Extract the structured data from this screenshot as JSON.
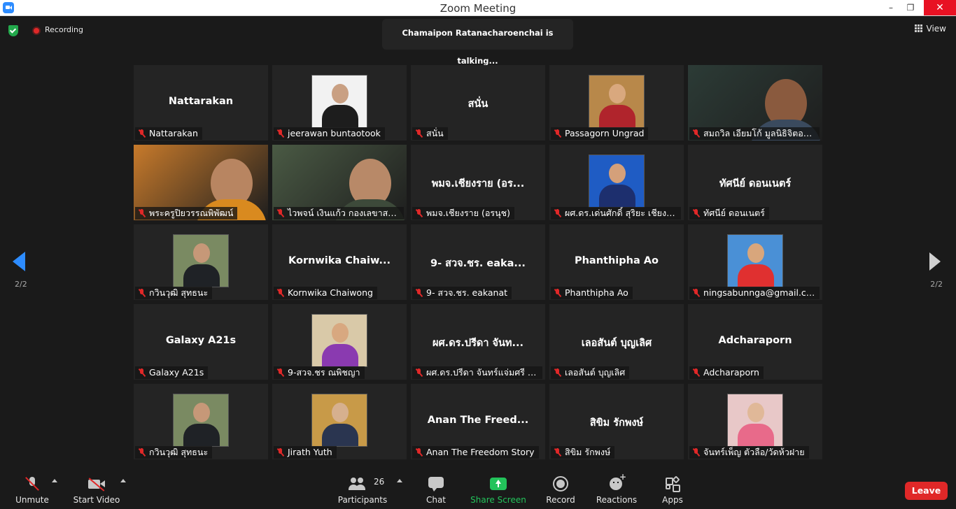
{
  "window": {
    "title": "Zoom Meeting",
    "minimize": "–",
    "maximize": "❐",
    "close": "✕"
  },
  "topbar": {
    "recording_label": "Recording",
    "talking_banner": "Chamaipon Ratanacharoenchai is talking...",
    "view_label": "View"
  },
  "pagination": {
    "left": "2/2",
    "right": "2/2"
  },
  "tiles": [
    {
      "name": "Nattarakan",
      "label": "Nattarakan",
      "kind": "name"
    },
    {
      "name": "",
      "label": "jeerawan buntaotook",
      "kind": "photo",
      "bg": "#f2f2f2",
      "skin": "#c9a083",
      "shirt": "#1d1d1d"
    },
    {
      "name": "สนั่น",
      "label": "สนั่น",
      "kind": "name"
    },
    {
      "name": "",
      "label": "Passagorn Ungrad",
      "kind": "photo",
      "bg": "#b8884a",
      "skin": "#d9a87e",
      "shirt": "#b0242c"
    },
    {
      "name": "",
      "label": "สมถวิล  เอียมโก้ มูลนิธิจิตอาสา เ...",
      "kind": "video",
      "bg": "#2c3b36",
      "skin": "#8a5a3e",
      "shirt": "#3a4a5e"
    },
    {
      "name": "",
      "label": "พระครูปิยวรรณพิพัฒน์",
      "kind": "video",
      "bg": "#c77a2b",
      "skin": "#b88561",
      "shirt": "#d98a1f"
    },
    {
      "name": "",
      "label": "ไวพจน์ เงินแก้ว กองเลขาสมัชช...",
      "kind": "video",
      "bg": "#4a5a44",
      "skin": "#b88968",
      "shirt": "#3d4a3a"
    },
    {
      "name": "พมจ.เชียงราย (อร...",
      "label": "พมจ.เชียงราย (อรนุช)",
      "kind": "name"
    },
    {
      "name": "",
      "label": "ผศ.ดร.เด่นศักดิ์ สุริยะ เชียงราย",
      "kind": "photo",
      "bg": "#1f5cc4",
      "skin": "#d4a07a",
      "shirt": "#1d2f6e"
    },
    {
      "name": "ทัศนีย์ ดอนเนตร์",
      "label": "ทัศนีย์ ดอนเนตร์",
      "kind": "name"
    },
    {
      "name": "",
      "label": "กวินวุฒิ สุทธนะ",
      "kind": "photo",
      "bg": "#7a8a62",
      "skin": "#c69878",
      "shirt": "#1f2226"
    },
    {
      "name": "Kornwika  Chaiw...",
      "label": "Kornwika Chaiwong",
      "kind": "name"
    },
    {
      "name": "9- สวจ.ชร. eaka...",
      "label": "9- สวจ.ชร. eakanat",
      "kind": "name"
    },
    {
      "name": "Phanthipha Ao",
      "label": "Phanthipha Ao",
      "kind": "name"
    },
    {
      "name": "",
      "label": "ningsabunnga@gmail.com",
      "kind": "photo",
      "bg": "#4a90d6",
      "skin": "#d8a67c",
      "shirt": "#e03030"
    },
    {
      "name": "Galaxy A21s",
      "label": "Galaxy A21s",
      "kind": "name"
    },
    {
      "name": "",
      "label": "9-สวจ.ชร ณพิชญา",
      "kind": "photo",
      "bg": "#d9c9a8",
      "skin": "#d8a880",
      "shirt": "#8a3ab0"
    },
    {
      "name": "ผศ.ดร.ปรีดา จันท...",
      "label": "ผศ.ดร.ปรีดา จันทร์แจ่มศรี  มร....",
      "kind": "name"
    },
    {
      "name": "เลอสันต์  บุญเลิศ",
      "label": "เลอสันต์  บุญเลิศ",
      "kind": "name"
    },
    {
      "name": "Adcharaporn",
      "label": "Adcharaporn",
      "kind": "name"
    },
    {
      "name": "",
      "label": "กวินวุฒิ สุทธนะ",
      "kind": "photo",
      "bg": "#7a8a62",
      "skin": "#c69878",
      "shirt": "#1f2226"
    },
    {
      "name": "",
      "label": "Jirath Yuth",
      "kind": "photo",
      "bg": "#c89a48",
      "skin": "#d6b08e",
      "shirt": "#2a3550"
    },
    {
      "name": "Anan The Freed...",
      "label": "Anan The Freedom Story",
      "kind": "name"
    },
    {
      "name": "สิขิม รักพงษ์",
      "label": "สิขิม รักพงษ์",
      "kind": "name"
    },
    {
      "name": "",
      "label": "จันทร์เพ็ญ ตัวลือ/วัดห้วฝาย",
      "kind": "photo",
      "bg": "#e8c8c8",
      "skin": "#e0b898",
      "shirt": "#e86a8a"
    }
  ],
  "toolbar": {
    "unmute": "Unmute",
    "start_video": "Start Video",
    "participants": "Participants",
    "participant_count": "26",
    "chat": "Chat",
    "share_screen": "Share Screen",
    "record": "Record",
    "reactions": "Reactions",
    "apps": "Apps",
    "leave": "Leave"
  },
  "colors": {
    "accent": "#2d8cff",
    "share": "#23c35b",
    "leave": "#e02828",
    "background": "#1a1a1a",
    "tile": "#242424"
  }
}
